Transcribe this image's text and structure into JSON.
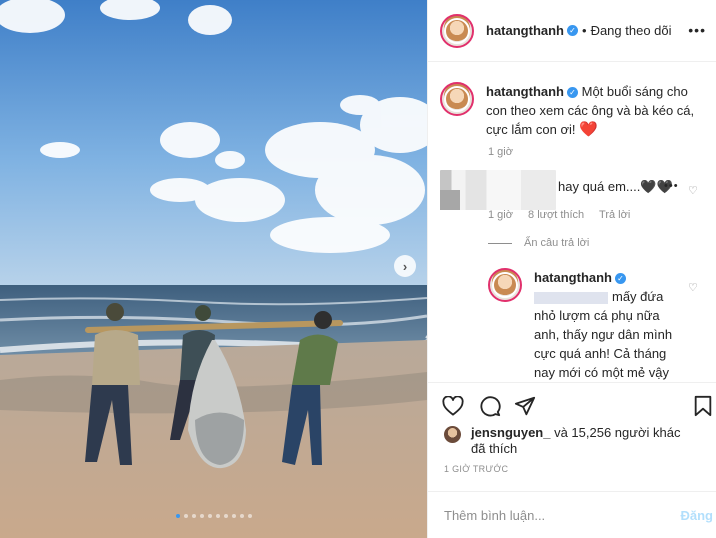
{
  "post": {
    "username": "hatangthanh",
    "follow_status": "Đang theo dõi",
    "separator": "•",
    "more": "•••",
    "carousel_dots": 10,
    "active_dot": 0
  },
  "caption": {
    "username": "hatangthanh",
    "text": "Một buổi sáng cho con theo xem các ông và bà kéo cá, cực lắm con ơi!",
    "emoji": "❤️",
    "time": "1 giờ"
  },
  "comments": [
    {
      "text": "hay quá em....🖤🖤",
      "time": "1 giờ",
      "likes": "8 lượt thích",
      "reply_label": "Trả lời",
      "more": "•••"
    }
  ],
  "hide_replies": "Ẩn câu trả lời",
  "reply": {
    "username": "hatangthanh",
    "text": "mấy đứa nhỏ lượm cá phụ nữa anh, thấy ngư dân mình cực quá anh! Cả tháng nay mới có một mẻ vậy đó anh"
  },
  "likes": {
    "user": "jensnguyen_",
    "rest": " và 15,256 người khác",
    "suffix": "đã thích"
  },
  "time_ago": "1 GIỜ TRƯỚC",
  "comment_box": {
    "placeholder": "Thêm bình luận...",
    "post_label": "Đăng"
  },
  "colors": {
    "verified": "#3897f0",
    "post_button_disabled": "#b2dffc",
    "heart_red": "#ed4956"
  }
}
